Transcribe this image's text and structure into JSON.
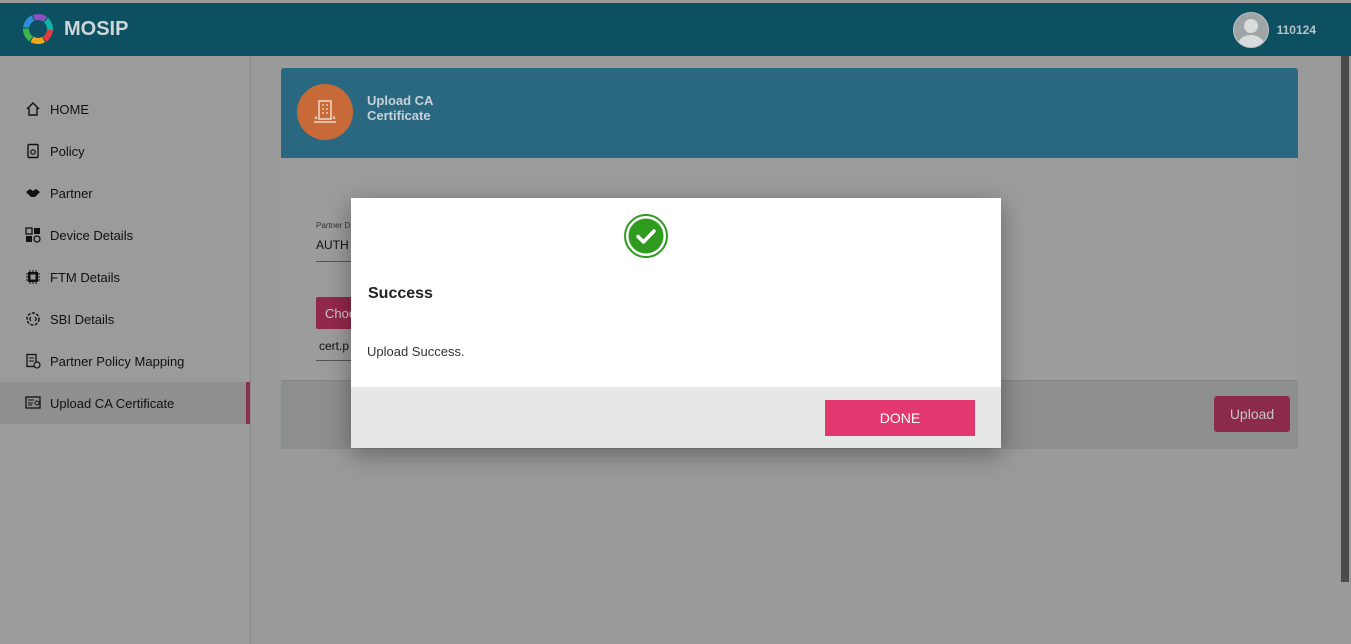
{
  "header": {
    "app_name": "MOSIP",
    "user_name": "110124"
  },
  "sidebar": {
    "items": [
      {
        "label": "HOME",
        "icon": "home-icon"
      },
      {
        "label": "Policy",
        "icon": "policy-icon"
      },
      {
        "label": "Partner",
        "icon": "handshake-icon"
      },
      {
        "label": "Device Details",
        "icon": "device-icon"
      },
      {
        "label": "FTM Details",
        "icon": "chip-icon"
      },
      {
        "label": "SBI Details",
        "icon": "code-gear-icon"
      },
      {
        "label": "Partner Policy Mapping",
        "icon": "mapping-icon"
      },
      {
        "label": "Upload CA Certificate",
        "icon": "certificate-icon",
        "active": true
      }
    ]
  },
  "card": {
    "title": "Upload CA Certificate",
    "partner_domain_label": "Partner D",
    "partner_domain_value": "AUTH",
    "choose_button": "Choo",
    "file_name": "cert.p",
    "upload_button": "Upload"
  },
  "modal": {
    "title": "Success",
    "message": "Upload Success.",
    "done_button": "DONE"
  },
  "colors": {
    "header": "#0c5061",
    "card_header": "#2a6780",
    "accent": "#e2376f",
    "success": "#2e9a1e"
  }
}
